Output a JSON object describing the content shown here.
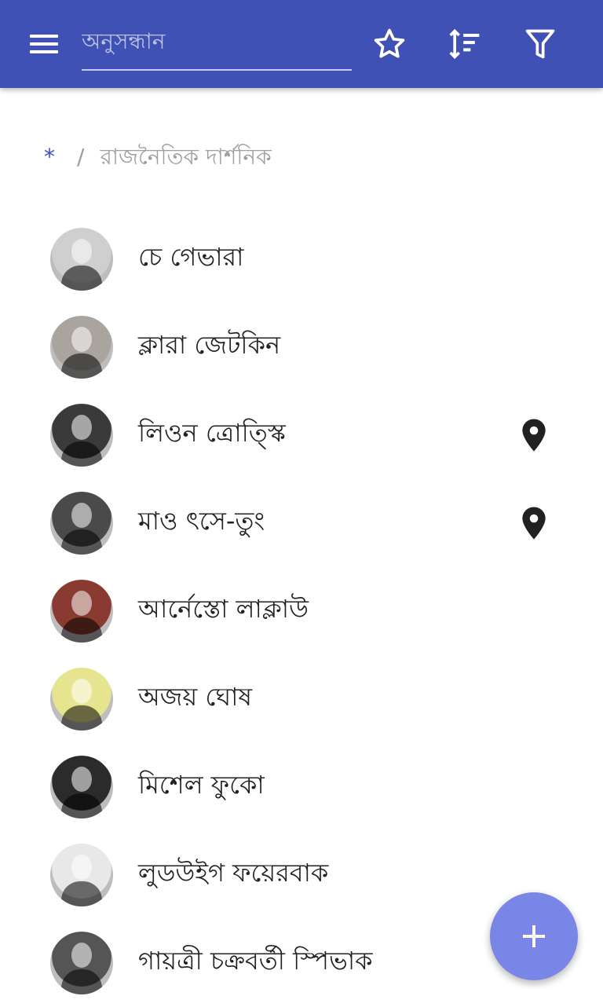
{
  "toolbar": {
    "search_placeholder": "অনুসন্ধান",
    "icons": [
      "menu-icon",
      "star-outline-icon",
      "sort-icon",
      "filter-icon"
    ],
    "background": "#3f51b5"
  },
  "breadcrumb": {
    "root": "*",
    "separator": "/",
    "current": "রাজনৈতিক দার্শনিক"
  },
  "list": {
    "items": [
      {
        "name": "চে গেভারা",
        "has_location": false,
        "avatar_tint": "#cfcfcf"
      },
      {
        "name": "ক্লারা জেটকিন",
        "has_location": false,
        "avatar_tint": "#a9a49d"
      },
      {
        "name": "লিওন ত্রোত্স্কি",
        "has_location": true,
        "avatar_tint": "#3a3a3a"
      },
      {
        "name": "মাও ৎসে-তুং",
        "has_location": true,
        "avatar_tint": "#4a4a4a"
      },
      {
        "name": "আর্নেস্তো লাক্লাউ",
        "has_location": false,
        "avatar_tint": "#8a3a30"
      },
      {
        "name": "অজয় ঘোষ",
        "has_location": false,
        "avatar_tint": "#e6e48e"
      },
      {
        "name": "মিশেল ফুকো",
        "has_location": false,
        "avatar_tint": "#2b2b2b"
      },
      {
        "name": "লুডউইগ ফয়েরবাক",
        "has_location": false,
        "avatar_tint": "#e8e8e8"
      },
      {
        "name": "গায়ত্রী চক্রবর্তী স্পিভাক",
        "has_location": false,
        "avatar_tint": "#555555"
      }
    ]
  },
  "fab": {
    "icon": "plus-icon",
    "color": "#7986e8"
  }
}
